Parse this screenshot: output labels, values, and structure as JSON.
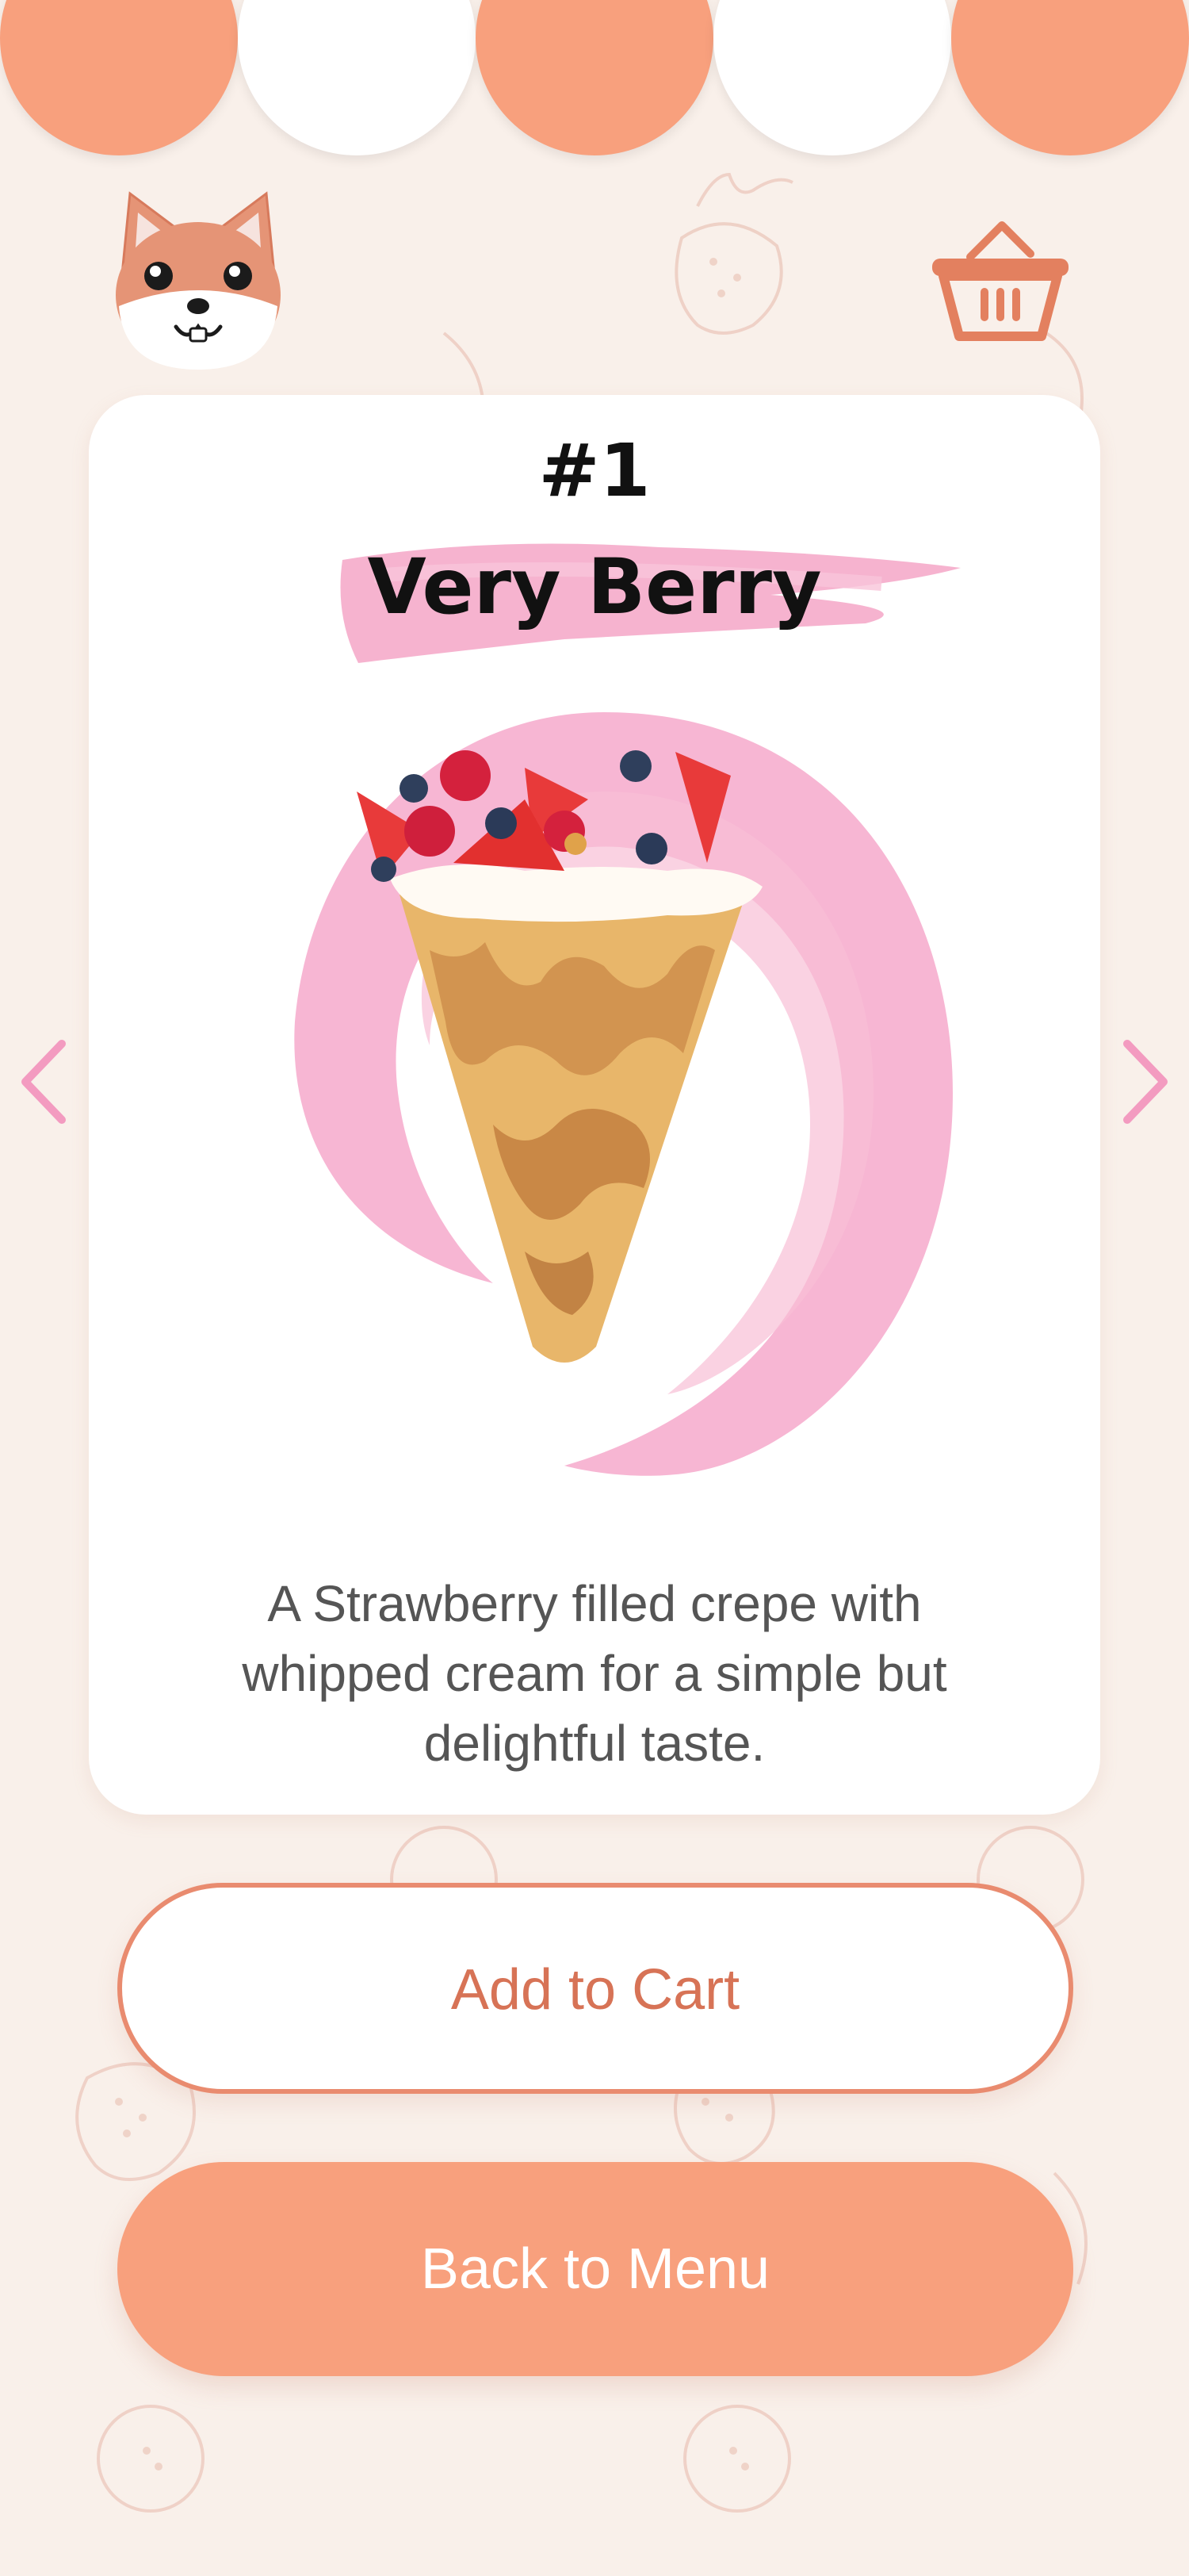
{
  "header": {
    "avatar_icon": "shiba-dog-icon",
    "cart_icon": "shopping-basket-icon"
  },
  "product": {
    "number": "#1",
    "name": "Very Berry",
    "description": "A Strawberry filled crepe with whipped cream for a simple but delightful taste.",
    "image_icon": "berry-crepe-image"
  },
  "navigation": {
    "prev_icon": "chevron-left-icon",
    "next_icon": "chevron-right-icon"
  },
  "actions": {
    "add_to_cart": "Add to Cart",
    "back_to_menu": "Back to Menu"
  },
  "colors": {
    "background": "#f9f0ea",
    "awning_orange": "#f8a07d",
    "awning_white": "#ffffff",
    "accent": "#e98b6f",
    "brush_pink": "#f3a1c6",
    "arrow_pink": "#f39bc0"
  }
}
